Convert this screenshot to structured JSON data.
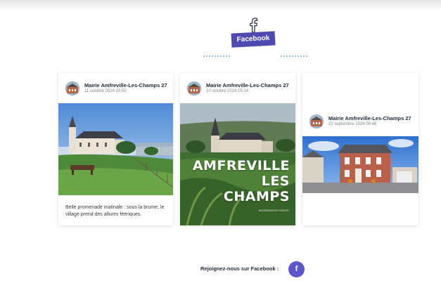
{
  "section": {
    "title": "Facebook",
    "icon": "facebook-icon"
  },
  "posts": [
    {
      "author": "Mairie Amfreville-Les-Champs 27",
      "date": "11 octobre 2024 10:50",
      "caption": "Belle promenade matinale : sous la brume, le village prend des allures féériques.",
      "image": "church-in-mist-photo"
    },
    {
      "author": "Mairie Amfreville-Les-Champs 27",
      "date": "10 octobre 2024 15:14",
      "image": "amfreville-poster-photo",
      "poster": {
        "line1": "AMFREVILLE",
        "line2": "LES",
        "line3": "CHAMPS",
        "tagline": "#NORMANDIEVIVANTE"
      }
    },
    {
      "author": "Mairie Amfreville-Les-Champs 27",
      "date": "22 septembre 2024 06:46",
      "image": "town-hall-photo"
    }
  ],
  "footer": {
    "join_text": "Rejoignez-nous sur Facebook :",
    "button_label": "f"
  },
  "colors": {
    "accent": "#4e4ab0",
    "button": "#5b56c9",
    "dots": "#8ec3d9"
  }
}
